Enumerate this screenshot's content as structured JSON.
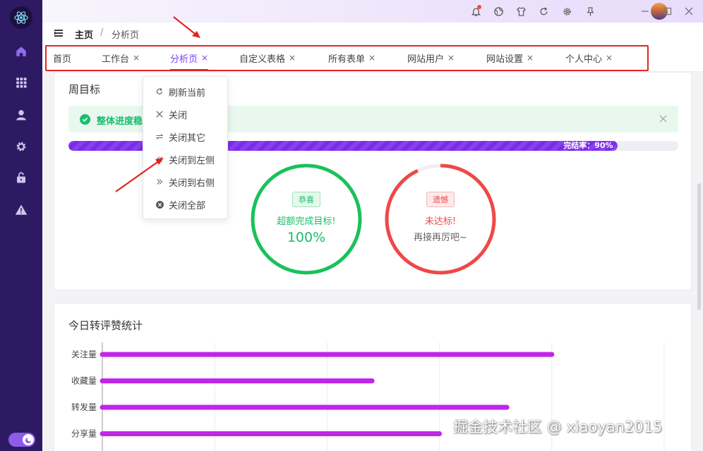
{
  "breadcrumb": {
    "home": "主页",
    "separator": "/",
    "current": "分析页"
  },
  "tabs": [
    {
      "label": "首页",
      "closable": false,
      "active": false
    },
    {
      "label": "工作台",
      "closable": true,
      "active": false
    },
    {
      "label": "分析页",
      "closable": true,
      "active": true
    },
    {
      "label": "自定义表格",
      "closable": true,
      "active": false
    },
    {
      "label": "所有表单",
      "closable": true,
      "active": false
    },
    {
      "label": "网站用户",
      "closable": true,
      "active": false
    },
    {
      "label": "网站设置",
      "closable": true,
      "active": false
    },
    {
      "label": "个人中心",
      "closable": true,
      "active": false
    }
  ],
  "tab_close_glyph": "×",
  "context_menu": [
    {
      "label": "刷新当前",
      "icon": "refresh-icon"
    },
    {
      "label": "关闭",
      "icon": "close-icon"
    },
    {
      "label": "关闭其它",
      "icon": "swap-icon"
    },
    {
      "label": "关闭到左侧",
      "icon": "double-chevron-left-icon"
    },
    {
      "label": "关闭到右侧",
      "icon": "double-chevron-right-icon"
    },
    {
      "label": "关闭全部",
      "icon": "close-circle-icon"
    }
  ],
  "weekly": {
    "title": "周目标",
    "alert_text": "整体进度稳",
    "progress_label": "完结率：90%",
    "progress_percent": 90,
    "rings": [
      {
        "tag": "恭喜",
        "line1": "超额完成目标!",
        "line2": "100%",
        "percent": 100,
        "color": "#19c25a",
        "tag_bg": "#e6f8ec",
        "tag_fg": "#19be6b"
      },
      {
        "tag": "遗憾",
        "line1": "未达标!",
        "line2": "再接再厉吧~",
        "percent": 93,
        "color": "#f04848",
        "tag_bg": "#fdeaea",
        "tag_fg": "#e84c4c"
      }
    ]
  },
  "daily": {
    "title": "今日转评赞统计"
  },
  "chart_data": {
    "type": "bar",
    "orientation": "horizontal",
    "categories": [
      "关注量",
      "收藏量",
      "转发量",
      "分享量"
    ],
    "values": [
      800,
      480,
      720,
      600
    ],
    "xlim": [
      0,
      1000
    ],
    "grid": true,
    "color": "#c026e8"
  },
  "watermark": "掘金技术社区 @ xiaoyan2015",
  "colors": {
    "accent": "#7b3ff2",
    "sidebar": "#2d1a63",
    "annotation": "#e02424"
  }
}
